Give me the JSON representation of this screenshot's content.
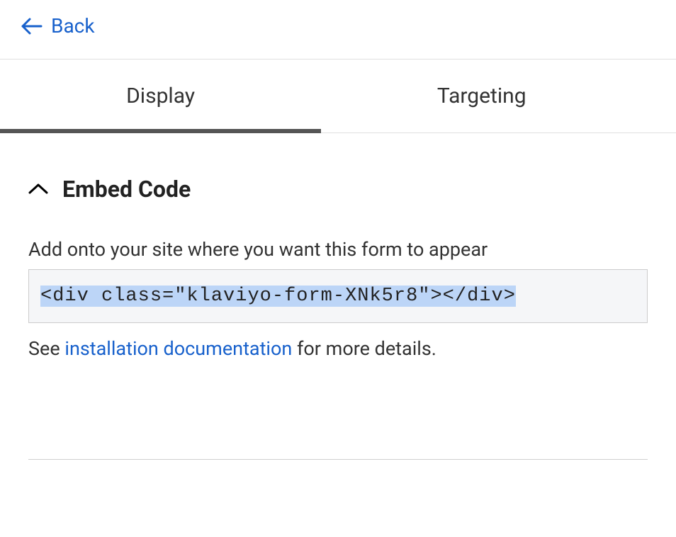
{
  "nav": {
    "back_label": "Back"
  },
  "tabs": [
    {
      "label": "Display",
      "active": true
    },
    {
      "label": "Targeting",
      "active": false
    }
  ],
  "section": {
    "title": "Embed Code",
    "instruction": "Add onto your site where you want this form to appear",
    "code": "<div class=\"klaviyo-form-XNk5r8\"></div>",
    "help_prefix": "See ",
    "help_link": "installation documentation",
    "help_suffix": " for more details."
  }
}
